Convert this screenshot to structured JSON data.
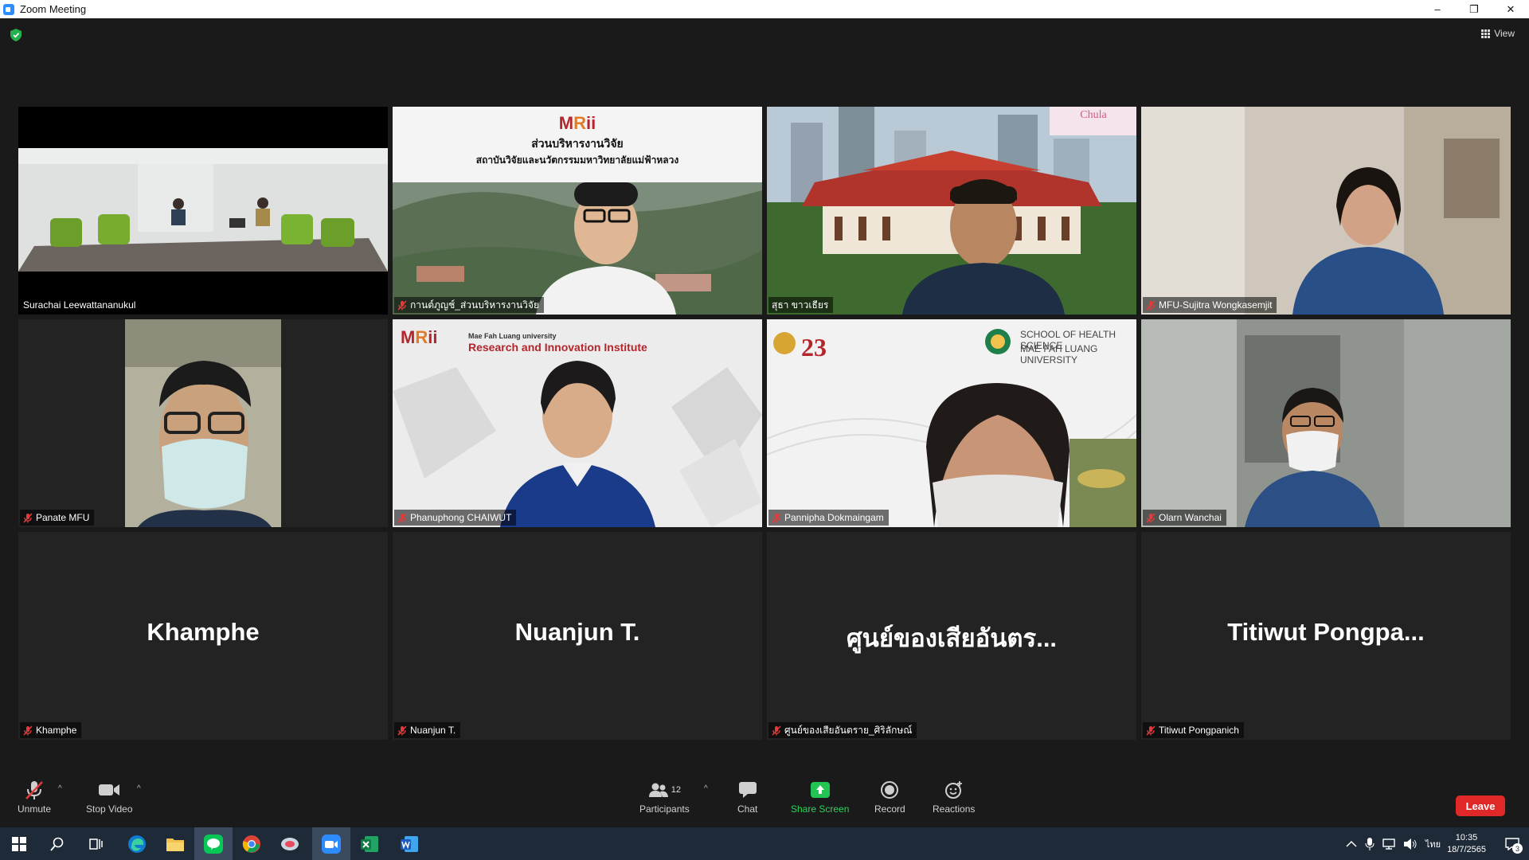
{
  "window": {
    "title": "Zoom Meeting",
    "controls": [
      "–",
      "❐",
      "✕"
    ]
  },
  "view": {
    "label": "View"
  },
  "tiles": [
    {
      "name": "Surachai Leewattananukul",
      "muted": false,
      "speaking": false
    },
    {
      "name": "กานต์ภูญช์_ส่วนบริหารงานวิจัย",
      "muted": true,
      "speaking": false,
      "bg_title": "ส่วนบริหารงานวิจัย",
      "bg_subtitle": "สถาบันวิจัยและนวัตกรรมมหาวิทยาลัยแม่ฟ้าหลวง"
    },
    {
      "name": "สุธา ขาวเธียร",
      "muted": false,
      "speaking": true,
      "bg_logo_text": "Chula"
    },
    {
      "name": "MFU-Sujitra Wongkasemjit",
      "muted": true,
      "speaking": false
    },
    {
      "name": "Panate MFU",
      "muted": true,
      "speaking": false
    },
    {
      "name": "Phanuphong CHAIWUT",
      "muted": true,
      "speaking": false,
      "bg_small": "Mae Fah Luang university",
      "bg_title": "Research and Innovation Institute"
    },
    {
      "name": "Pannipha Dokmaingam",
      "muted": true,
      "speaking": false,
      "bg_number": "23",
      "bg_line1": "SCHOOL OF HEALTH SCIENCE",
      "bg_line2": "MAE FAH LUANG UNIVERSITY"
    },
    {
      "name": "Olarn Wanchai",
      "muted": true,
      "speaking": false
    },
    {
      "name": "Khamphe",
      "display": "Khamphe",
      "muted": true,
      "speaking": false
    },
    {
      "name": "Nuanjun T.",
      "display": "Nuanjun T.",
      "muted": true,
      "speaking": false
    },
    {
      "name": "ศูนย์ของเสียอันตราย_ศิริลักษณ์",
      "display": "ศูนย์ของเสียอันตร...",
      "muted": true,
      "speaking": false
    },
    {
      "name": "Titiwut Pongpanich",
      "display": "Titiwut  Pongpa...",
      "muted": true,
      "speaking": false
    }
  ],
  "toolbar": {
    "unmute": "Unmute",
    "stop_video": "Stop Video",
    "participants": "Participants",
    "participants_count": "12",
    "chat": "Chat",
    "share_screen": "Share Screen",
    "record": "Record",
    "reactions": "Reactions",
    "leave": "Leave"
  },
  "taskbar": {
    "apps": [
      "start",
      "search",
      "task-view",
      "edge",
      "file-explorer",
      "line",
      "chrome",
      "browser",
      "zoom",
      "excel",
      "word"
    ],
    "language": "ไทย",
    "time": "10:35",
    "date": "18/7/2565",
    "notification_count": "3"
  },
  "colors": {
    "speaking_border": "#d7e04a",
    "leave": "#e02828",
    "share": "#2dd45a",
    "mfu_red": "#b3262c"
  }
}
